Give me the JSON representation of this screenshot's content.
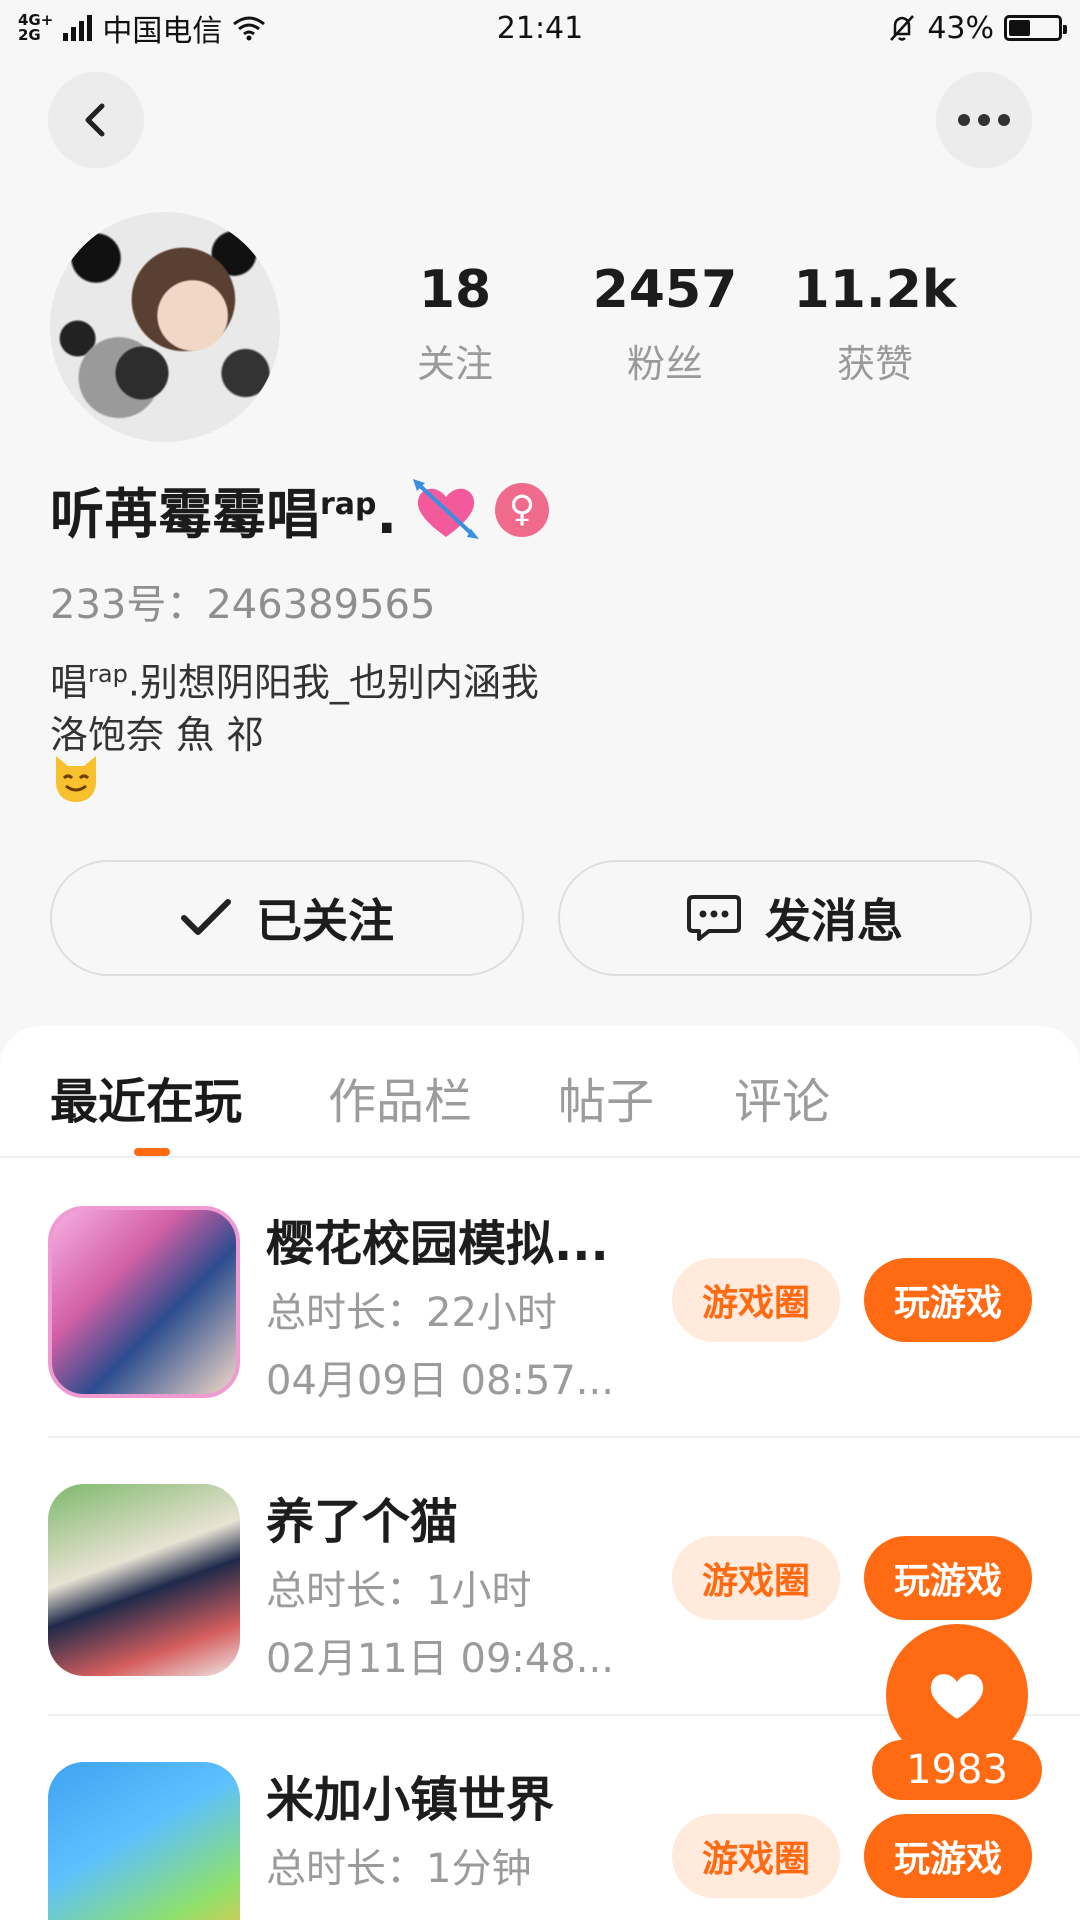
{
  "status_bar": {
    "network_top": "4G+",
    "network_bottom": "2G",
    "carrier": "中国电信",
    "time": "21:41",
    "battery": "43%",
    "battery_level": 0.43
  },
  "profile": {
    "stats": [
      {
        "value": "18",
        "label": "关注"
      },
      {
        "value": "2457",
        "label": "粉丝"
      },
      {
        "value": "11.2k",
        "label": "获赞"
      }
    ],
    "name_prefix": "听苒霉霉唱",
    "name_sup": "rap",
    "name_suffix": ".",
    "gender_symbol": "♀",
    "id_line": "233号：246389565",
    "bio_line1_pre": "唱",
    "bio_line1_sup": "rap",
    "bio_line1_post": ".别想阴阳我_也别内涵我",
    "bio_line2": "洛饱奈 魚 祁"
  },
  "actions": {
    "follow_label": "已关注",
    "message_label": "发消息"
  },
  "tabs": [
    "最近在玩",
    "作品栏",
    "帖子",
    "评论"
  ],
  "games": [
    {
      "title": "樱花校园模拟...",
      "duration": "总时长：22小时",
      "date": "04月09日 08:57...",
      "circle_label": "游戏圈",
      "play_label": "玩游戏"
    },
    {
      "title": "养了个猫",
      "duration": "总时长：1小时",
      "date": "02月11日 09:48...",
      "circle_label": "游戏圈",
      "play_label": "玩游戏"
    },
    {
      "title": "米加小镇世界",
      "duration": "总时长：1分钟",
      "date": "",
      "circle_label": "游戏圈",
      "play_label": "玩游戏"
    }
  ],
  "like_fab": {
    "count": "1983"
  },
  "icons": {
    "back": "chevron-left-icon",
    "more": "more-dots-icon",
    "check": "check-icon",
    "chat": "chat-bubble-icon",
    "heart": "heart-icon"
  },
  "colors": {
    "accent": "#ff6a13",
    "accent_light": "#ffeadc",
    "gender_badge": "#f06a8c"
  }
}
